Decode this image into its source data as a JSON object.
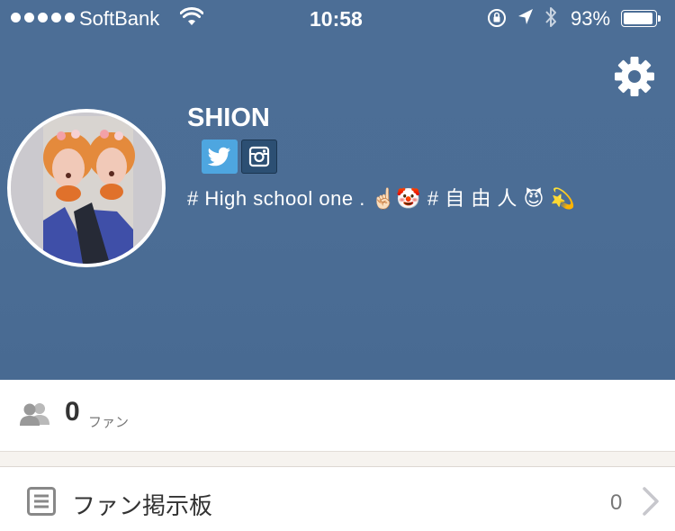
{
  "status_bar": {
    "carrier": "SoftBank",
    "time": "10:58",
    "battery": "93%"
  },
  "profile": {
    "username": "SHION",
    "bio": "# High school one . ☝🏻🤡 #  自 由 人 😈  💫",
    "social": [
      "twitter-icon",
      "instagram-icon"
    ]
  },
  "fans": {
    "count": "0",
    "label": "ファン"
  },
  "board": {
    "label": "ファン掲示板",
    "count": "0"
  },
  "colors": {
    "header_bg": "#4b6d95",
    "twitter": "#4ea6e0",
    "instagram": "#2c4f73"
  }
}
